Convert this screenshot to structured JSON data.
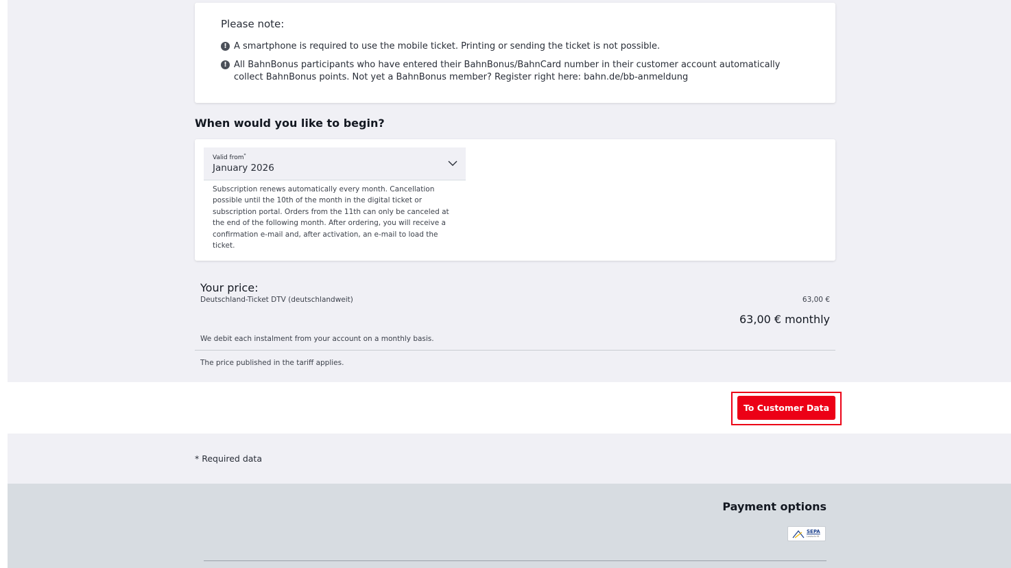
{
  "note": {
    "title": "Please note:",
    "items": [
      "A smartphone is required to use the mobile ticket. Printing or sending the ticket is not possible.",
      "All BahnBonus participants who have entered their BahnBonus/BahnCard number in their customer account automatically collect BahnBonus points. Not yet a BahnBonus member? Register right here: bahn.de/bb-anmeldung"
    ],
    "icon": "exclamation-circle-icon"
  },
  "start": {
    "heading": "When would you like to begin?",
    "valid_from_label": "Valid from",
    "required_mark": "*",
    "valid_from_value": "January 2026",
    "help_text": "Subscription renews automatically every month. Cancellation possible until the 10th of the month in the digital ticket or subscription portal. Orders from the 11th can only be canceled at the end of the following month. After ordering, you will receive a confirmation e-mail and, after activation, an e-mail to load the ticket."
  },
  "price": {
    "title": "Your price:",
    "item_name": "Deutschland-Ticket DTV (deutschlandweit)",
    "item_amount": "63,00 €",
    "total": "63,00 € monthly",
    "debit_note": "We debit each instalment from your account on a monthly basis.",
    "tariff_note": "The price published in the tariff applies."
  },
  "actions": {
    "continue_label": "To Customer Data",
    "accent_color": "#ec0016"
  },
  "required_note": "* Required data",
  "footer": {
    "payment_title": "Payment options",
    "sepa_label": "SEPA",
    "sepa_sub": "Lastschrift"
  }
}
